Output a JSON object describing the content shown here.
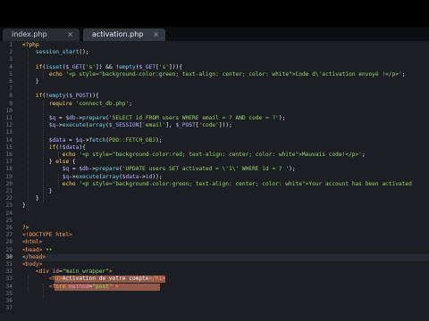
{
  "tabs": [
    {
      "label": "index.php",
      "close": "×",
      "active": false
    },
    {
      "label": "activation.php",
      "close": "×",
      "active": true
    }
  ],
  "line_numbers": [
    "1",
    "2",
    "3",
    "4",
    "5",
    "6",
    "7",
    "8",
    "9",
    "10",
    "11",
    "12",
    "13",
    "14",
    "15",
    "16",
    "17",
    "18",
    "19",
    "20",
    "21",
    "22",
    "23",
    "24",
    "25",
    "26",
    "27",
    "28",
    "29",
    "30",
    "31",
    "32",
    "33",
    "34",
    "35",
    "36",
    "37"
  ],
  "code_lines": [
    [
      [
        "k",
        "<?php"
      ]
    ],
    [
      [
        "o",
        "    "
      ],
      [
        "f",
        "session_start"
      ],
      [
        "o",
        "();"
      ]
    ],
    [],
    [
      [
        "o",
        "    "
      ],
      [
        "k",
        "if"
      ],
      [
        "o",
        "("
      ],
      [
        "f",
        "isset"
      ],
      [
        "o",
        "("
      ],
      [
        "v",
        "$_GET"
      ],
      [
        "o",
        "["
      ],
      [
        "s",
        "'s'"
      ],
      [
        "o",
        "]) && !"
      ],
      [
        "f",
        "empty"
      ],
      [
        "o",
        "("
      ],
      [
        "v",
        "$_GET"
      ],
      [
        "o",
        "["
      ],
      [
        "s",
        "'s'"
      ],
      [
        "o",
        "])){"
      ]
    ],
    [
      [
        "o",
        "        "
      ],
      [
        "k",
        "echo"
      ],
      [
        "o",
        " "
      ],
      [
        "s",
        "'<p style=\"background-color:green; text-align: center; color: white\">Code d\\'activation envoyé !</p>'"
      ],
      [
        "o",
        ";"
      ]
    ],
    [
      [
        "o",
        "    }"
      ]
    ],
    [],
    [
      [
        "o",
        "    "
      ],
      [
        "k",
        "if"
      ],
      [
        "o",
        "(!"
      ],
      [
        "f",
        "empty"
      ],
      [
        "o",
        "("
      ],
      [
        "v",
        "$_POST"
      ],
      [
        "o",
        "))"
      ],
      [
        "o",
        "{"
      ]
    ],
    [
      [
        "o",
        "        "
      ],
      [
        "k",
        "require"
      ],
      [
        "o",
        " "
      ],
      [
        "s",
        "'connect_db.php'"
      ],
      [
        "o",
        ";"
      ]
    ],
    [],
    [
      [
        "o",
        "        "
      ],
      [
        "v",
        "$q"
      ],
      [
        "o",
        " = "
      ],
      [
        "v",
        "$db"
      ],
      [
        "o",
        "->"
      ],
      [
        "f",
        "prepare"
      ],
      [
        "o",
        "("
      ],
      [
        "s",
        "'SELECT id FROM users WHERE email = ? AND code = ?'"
      ],
      [
        "o",
        ");"
      ]
    ],
    [
      [
        "o",
        "        "
      ],
      [
        "v",
        "$q"
      ],
      [
        "o",
        "->"
      ],
      [
        "f",
        "execute"
      ],
      [
        "o",
        "("
      ],
      [
        "f",
        "array"
      ],
      [
        "o",
        "("
      ],
      [
        "v",
        "$_SESSION"
      ],
      [
        "o",
        "["
      ],
      [
        "s",
        "'email'"
      ],
      [
        "o",
        "], "
      ],
      [
        "v",
        "$_POST"
      ],
      [
        "o",
        "["
      ],
      [
        "s",
        "'code'"
      ],
      [
        "o",
        "]));"
      ]
    ],
    [],
    [
      [
        "o",
        "        "
      ],
      [
        "v",
        "$data"
      ],
      [
        "o",
        " = "
      ],
      [
        "v",
        "$q"
      ],
      [
        "o",
        "->"
      ],
      [
        "f",
        "fetch"
      ],
      [
        "o",
        "("
      ],
      [
        "c",
        "PDO::FETCH_OBJ"
      ],
      [
        "o",
        ");"
      ]
    ],
    [
      [
        "o",
        "        "
      ],
      [
        "k",
        "if"
      ],
      [
        "o",
        "(!"
      ],
      [
        "v",
        "$data"
      ],
      [
        "o",
        ")"
      ],
      [
        "o",
        "{"
      ]
    ],
    [
      [
        "o",
        "            "
      ],
      [
        "k",
        "echo"
      ],
      [
        "o",
        " "
      ],
      [
        "s",
        "'<p style=\"background-color:red; text-align: center; color: white\">Mauvais code!</p>'"
      ],
      [
        "o",
        ";"
      ]
    ],
    [
      [
        "o",
        "        } "
      ],
      [
        "k",
        "else"
      ],
      [
        "o",
        " {"
      ]
    ],
    [
      [
        "o",
        "            "
      ],
      [
        "v",
        "$q"
      ],
      [
        "o",
        " = "
      ],
      [
        "v",
        "$db"
      ],
      [
        "o",
        "->"
      ],
      [
        "f",
        "prepare"
      ],
      [
        "o",
        "("
      ],
      [
        "s",
        "'UPDATE users SET activated = \\'1\\' WHERE id = ? '"
      ],
      [
        "o",
        ");"
      ]
    ],
    [
      [
        "o",
        "            "
      ],
      [
        "v",
        "$q"
      ],
      [
        "o",
        "->"
      ],
      [
        "f",
        "execute"
      ],
      [
        "o",
        "("
      ],
      [
        "f",
        "array"
      ],
      [
        "o",
        "("
      ],
      [
        "v",
        "$data"
      ],
      [
        "o",
        "->"
      ],
      [
        "v",
        "id"
      ],
      [
        "o",
        "));"
      ]
    ],
    [
      [
        "o",
        "            "
      ],
      [
        "k",
        "echo"
      ],
      [
        "o",
        " "
      ],
      [
        "s",
        "'<p style=\"background-color:green; text-align: center; color: white\">Your account has been activated"
      ]
    ],
    [
      [
        "o",
        "        }"
      ]
    ],
    [
      [
        "o",
        "    }"
      ]
    ],
    [
      [
        "o",
        "}"
      ]
    ],
    [],
    [],
    [
      [
        "k",
        "?>"
      ]
    ],
    [
      [
        "t",
        "<!DOCTYPE html>"
      ]
    ],
    [
      [
        "t",
        "<html>"
      ]
    ],
    [
      [
        "t",
        "<head>"
      ],
      [
        "s",
        " ••"
      ]
    ],
    [
      [
        "t",
        "</head>"
      ]
    ],
    [
      [
        "t",
        "<body>"
      ]
    ],
    [
      [
        "o",
        "    "
      ],
      [
        "t",
        "<div "
      ],
      [
        "a",
        "id"
      ],
      [
        "o",
        "="
      ],
      [
        "s",
        "\"main_wrapper\""
      ],
      [
        "t",
        ">"
      ]
    ],
    [
      [
        "o",
        "        "
      ],
      [
        "t",
        "<h1>"
      ],
      [
        "o",
        "Activation de votre compte"
      ],
      [
        "t",
        "</h1>"
      ]
    ],
    [
      [
        "o",
        "        "
      ],
      [
        "t",
        "<form "
      ],
      [
        "a",
        "method"
      ],
      [
        "o",
        "="
      ],
      [
        "s",
        "\"post\""
      ],
      [
        "o",
        " "
      ],
      [
        "t",
        ">"
      ]
    ],
    [],
    [],
    []
  ],
  "colors": {
    "editor_bg": "#1c1e24",
    "keyword": "#f4d35a",
    "function": "#72d6ea",
    "string": "#96d76a",
    "tag": "#ff9c5a",
    "selection": "#f28c6a"
  }
}
